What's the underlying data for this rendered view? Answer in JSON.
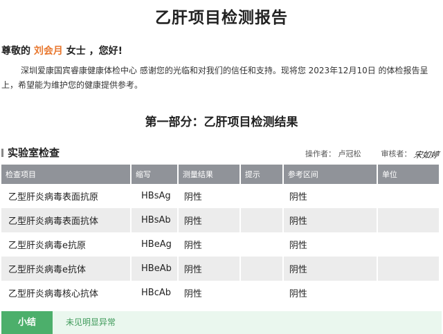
{
  "report": {
    "title": "乙肝项目检测报告",
    "greeting_prefix": "尊敬的",
    "patient_name": "刘会月",
    "greeting_suffix": "女士 ，您好!",
    "intro": "深圳爱康国宾睿康健康体检中心 感谢您的光临和对我们的信任和支持。现将您 2023年12月10日 的体检报告呈上，希望能为维护您的健康提供参考。",
    "section_title": "第一部分：乙肝项目检测结果"
  },
  "lab": {
    "title": "实验室检查",
    "operator_label": "操作者：",
    "operator_name": "卢冠松",
    "reviewer_label": "审核者：",
    "reviewer_signature": "宋如婷"
  },
  "table": {
    "headers": [
      "检查项目",
      "缩写",
      "测量结果",
      "提示",
      "参考区间",
      "单位"
    ],
    "rows": [
      [
        "乙型肝炎病毒表面抗原",
        "HBsAg",
        "阴性",
        "",
        "阴性",
        ""
      ],
      [
        "乙型肝炎病毒表面抗体",
        "HBsAb",
        "阴性",
        "",
        "阴性",
        ""
      ],
      [
        "乙型肝炎病毒e抗原",
        "HBeAg",
        "阴性",
        "",
        "阴性",
        ""
      ],
      [
        "乙型肝炎病毒e抗体",
        "HBeAb",
        "阴性",
        "",
        "阴性",
        ""
      ],
      [
        "乙型肝炎病毒核心抗体",
        "HBcAb",
        "阴性",
        "",
        "阴性",
        ""
      ]
    ]
  },
  "summary": {
    "label": "小结",
    "text": "未见明显异常"
  },
  "colors": {
    "accent_name": "#e8772e",
    "header_bg": "#909399",
    "summary_green": "#4caf6b"
  }
}
